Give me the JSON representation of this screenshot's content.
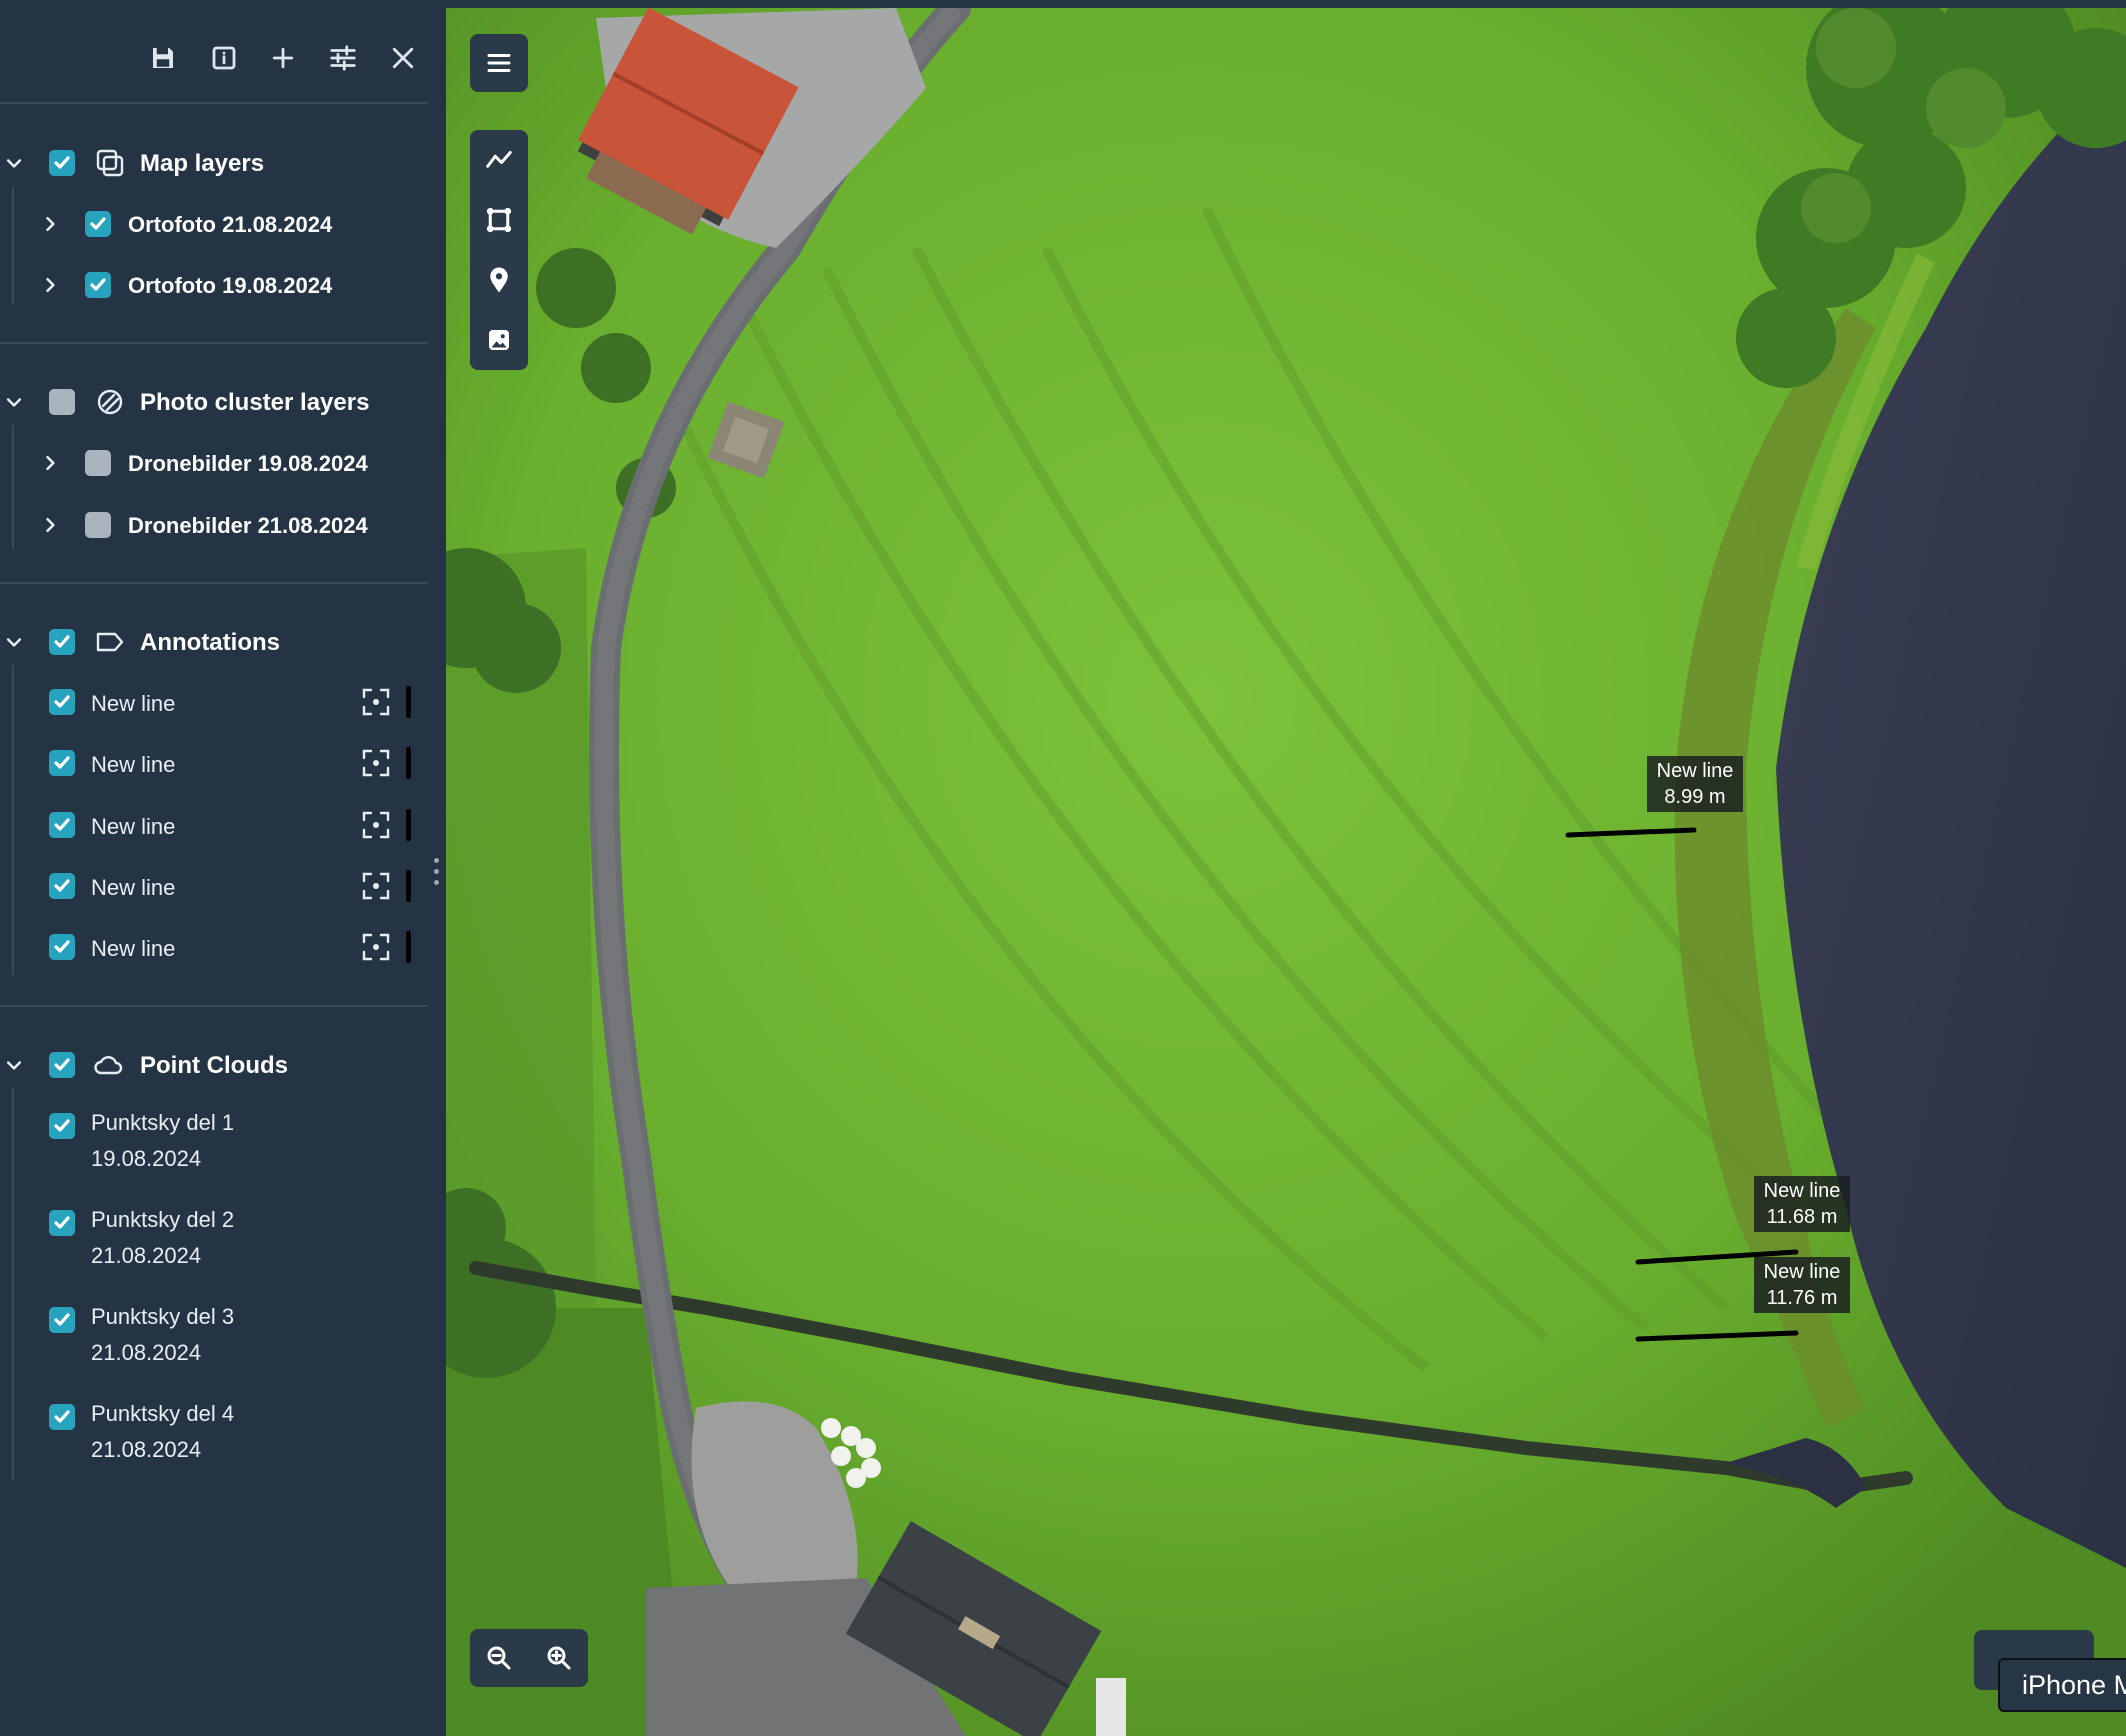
{
  "toolbar": {
    "buttons": [
      {
        "icon": "save-icon"
      },
      {
        "icon": "info-icon"
      },
      {
        "icon": "plus-icon"
      },
      {
        "icon": "sliders-icon"
      },
      {
        "icon": "close-icon"
      }
    ]
  },
  "sections": {
    "map_layers": {
      "title": "Map layers",
      "checked": true,
      "items": [
        {
          "label": "Ortofoto 21.08.2024",
          "checked": true
        },
        {
          "label": "Ortofoto 19.08.2024",
          "checked": true
        }
      ]
    },
    "photo_clusters": {
      "title": "Photo cluster layers",
      "checked": false,
      "items": [
        {
          "label": "Dronebilder 19.08.2024",
          "checked": false
        },
        {
          "label": "Dronebilder 21.08.2024",
          "checked": false
        }
      ]
    },
    "annotations": {
      "title": "Annotations",
      "checked": true,
      "items": [
        {
          "label": "New line",
          "checked": true,
          "color": "#000000"
        },
        {
          "label": "New line",
          "checked": true,
          "color": "#000000"
        },
        {
          "label": "New line",
          "checked": true,
          "color": "#000000"
        },
        {
          "label": "New line",
          "checked": true,
          "color": "#000000"
        },
        {
          "label": "New line",
          "checked": true,
          "color": "#000000"
        }
      ]
    },
    "point_clouds": {
      "title": "Point Clouds",
      "checked": true,
      "items": [
        {
          "line1": "Punktsky del 1",
          "line2": "19.08.2024",
          "checked": true
        },
        {
          "line1": "Punktsky del 2",
          "line2": "21.08.2024",
          "checked": true
        },
        {
          "line1": "Punktsky del 3",
          "line2": "21.08.2024",
          "checked": true
        },
        {
          "line1": "Punktsky del 4",
          "line2": "21.08.2024",
          "checked": true
        }
      ]
    }
  },
  "map": {
    "measurements": [
      {
        "name": "New line",
        "length": "8.99 m"
      },
      {
        "name": "New line",
        "length": "11.68 m"
      },
      {
        "name": "New line",
        "length": "11.76 m"
      }
    ],
    "device_tooltip": "iPhone M"
  },
  "colors": {
    "sidebar_bg": "#253444",
    "accent": "#27a3bd",
    "unchecked": "#aab4be"
  }
}
